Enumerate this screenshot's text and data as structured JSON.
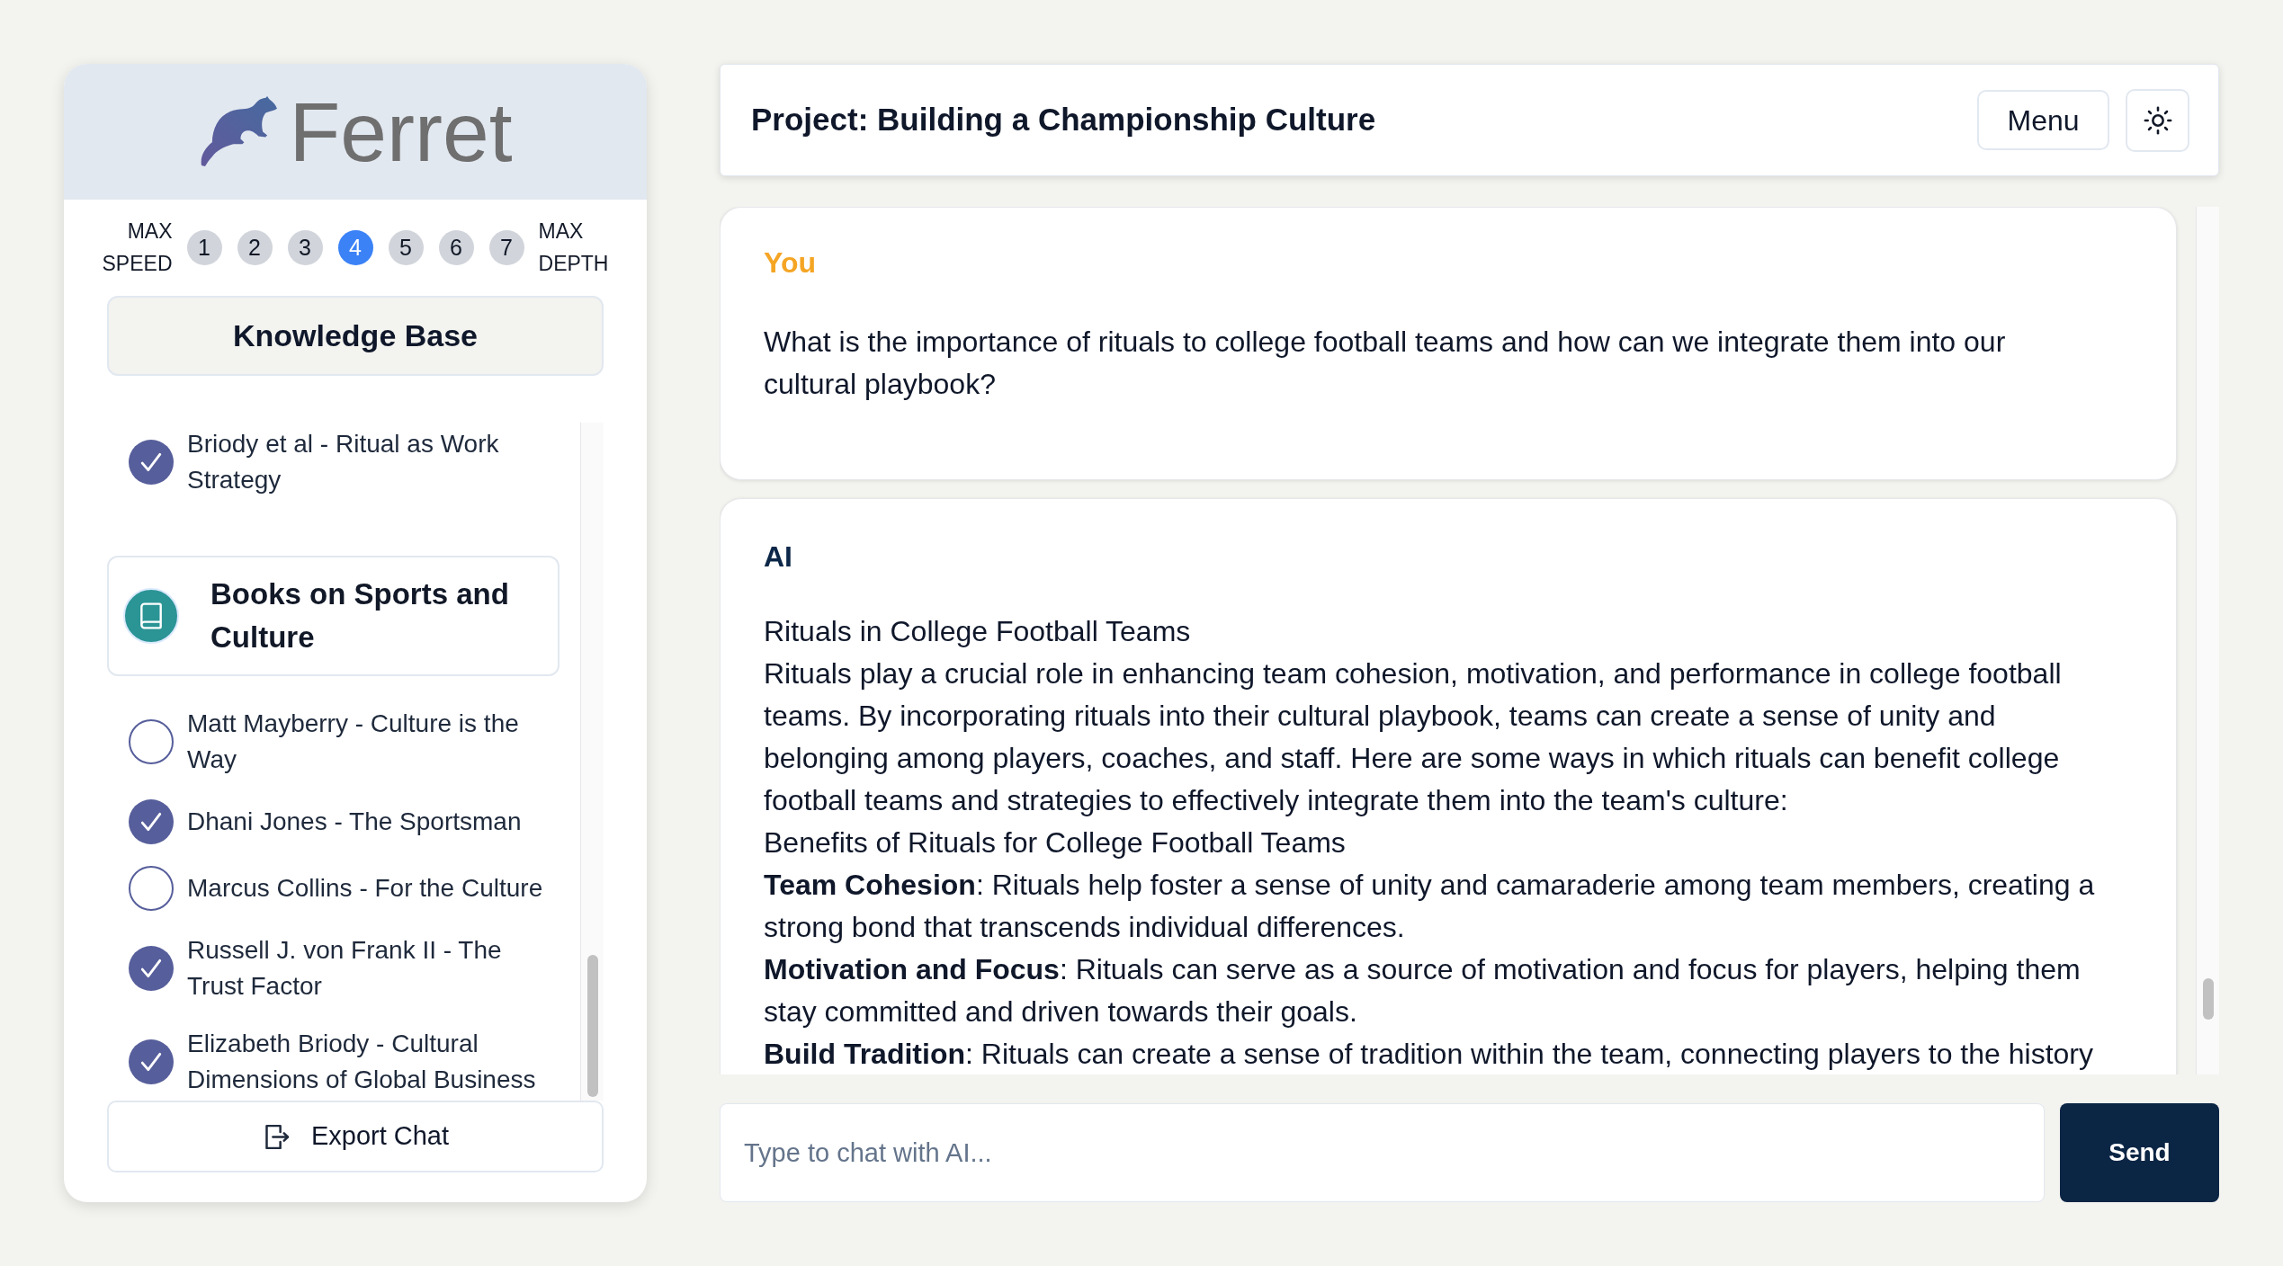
{
  "sidebar": {
    "logo_text": "Ferret",
    "depth_scale": {
      "left_label": "MAX SPEED",
      "right_label": "MAX DEPTH",
      "levels": [
        {
          "label": "1",
          "selected": false
        },
        {
          "label": "2",
          "selected": false
        },
        {
          "label": "3",
          "selected": false
        },
        {
          "label": "4",
          "selected": true
        },
        {
          "label": "5",
          "selected": false
        },
        {
          "label": "6",
          "selected": false
        },
        {
          "label": "7",
          "selected": false
        }
      ]
    },
    "knowledge_base_button": "Knowledge Base",
    "sources": [
      {
        "kind": "document",
        "title": "Briody et al - Ritual as Work Strategy",
        "checked": true
      },
      {
        "kind": "collection",
        "title": "Books on Sports and Culture"
      },
      {
        "kind": "document",
        "title": "Matt Mayberry - Culture is the Way",
        "checked": false
      },
      {
        "kind": "document",
        "title": "Dhani Jones - The Sportsman",
        "checked": true
      },
      {
        "kind": "document",
        "title": "Marcus Collins - For the Culture",
        "checked": false
      },
      {
        "kind": "document",
        "title": "Russell J. von Frank II - The Trust Factor",
        "checked": true
      },
      {
        "kind": "document",
        "title": "Elizabeth Briody - Cultural Dimensions of Global Business",
        "checked": true
      }
    ],
    "export_button": "Export Chat"
  },
  "header": {
    "title": "Project: Building a Championship Culture",
    "menu_button": "Menu"
  },
  "messages": [
    {
      "kind": "user",
      "sender": "You",
      "paragraphs": [
        "What is the importance of rituals to college football teams and how can we integrate them into our cultural playbook?"
      ]
    },
    {
      "kind": "ai",
      "sender": "AI",
      "paragraphs": [
        "Rituals in College Football Teams",
        "Rituals play a crucial role in enhancing team cohesion, motivation, and performance in college football teams. By incorporating rituals into their cultural playbook, teams can create a sense of unity and belonging among players, coaches, and staff. Here are some ways in which rituals can benefit college football teams and strategies to effectively integrate them into the team's culture:",
        "Benefits of Rituals for College Football Teams",
        "**Team Cohesion**: Rituals help foster a sense of unity and camaraderie among team members, creating a strong bond that transcends individual differences.",
        "**Motivation and Focus**: Rituals can serve as a source of motivation and focus for players, helping them stay committed and driven towards their goals.",
        "**Build Tradition**: Rituals can create a sense of tradition within the team, connecting players to the history"
      ]
    }
  ],
  "composer": {
    "placeholder": "Type to chat with AI...",
    "send_button": "Send"
  }
}
